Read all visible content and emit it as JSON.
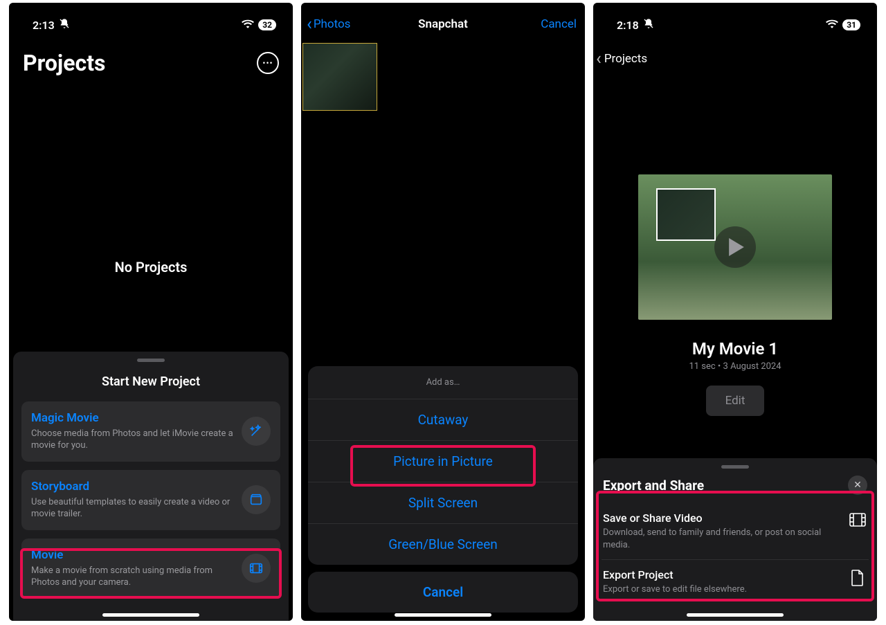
{
  "screen1": {
    "status_time": "2:13",
    "battery": "32",
    "title": "Projects",
    "empty": "No Projects",
    "sheet_title": "Start New Project",
    "cards": [
      {
        "title": "Magic Movie",
        "subtitle": "Choose media from Photos and let iMovie create a movie for you.",
        "icon": "magic-wand-icon"
      },
      {
        "title": "Storyboard",
        "subtitle": "Use beautiful templates to easily create a video or movie trailer.",
        "icon": "storyboard-icon"
      },
      {
        "title": "Movie",
        "subtitle": "Make a movie from scratch using media from Photos and your camera.",
        "icon": "film-icon"
      }
    ]
  },
  "screen2": {
    "back": "Photos",
    "title": "Snapchat",
    "cancel": "Cancel",
    "sheet_header": "Add as…",
    "items": [
      "Cutaway",
      "Picture in Picture",
      "Split Screen",
      "Green/Blue Screen"
    ],
    "sheet_cancel": "Cancel"
  },
  "screen3": {
    "status_time": "2:18",
    "battery": "31",
    "back": "Projects",
    "movie_title": "My Movie 1",
    "movie_sub": "11 sec • 3 August 2024",
    "edit": "Edit",
    "sheet_title": "Export and Share",
    "rows": [
      {
        "title": "Save or Share Video",
        "subtitle": "Download, send to family and friends, or post on social media.",
        "icon": "video-icon"
      },
      {
        "title": "Export Project",
        "subtitle": "Export or save to edit file elsewhere.",
        "icon": "document-icon"
      }
    ]
  }
}
